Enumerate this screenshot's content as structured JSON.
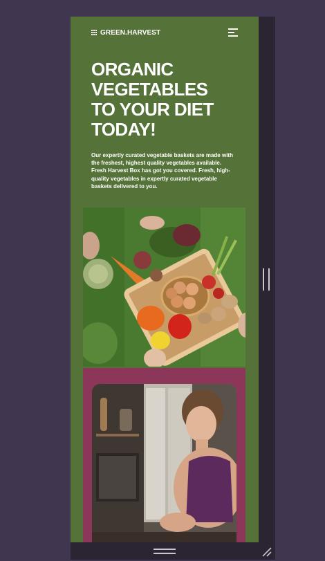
{
  "site": {
    "brand": "GREEN.HARVEST"
  },
  "hero": {
    "title_lines": [
      "ORGANIC",
      "VEGETABLES",
      "TO YOUR DIET",
      "TODAY!"
    ],
    "description": "Our expertly curated vegetable baskets are made with the freshest, highest quality vegetables available. Fresh Harvest Box has got you covered. Fresh, high-quality vegetables in expertly curated vegetable baskets delivered to you."
  },
  "icons": {
    "logo": "grid-logo-icon",
    "menu": "hamburger-menu-icon",
    "vertical_resize": "vertical-resize-handle-icon",
    "horizontal_resize": "horizontal-resize-handle-icon",
    "corner_resize": "corner-resize-icon"
  },
  "colors": {
    "page_background": "#403650",
    "hero_background": "#557338",
    "card_background": "#8c3659",
    "text": "#ffffff"
  }
}
